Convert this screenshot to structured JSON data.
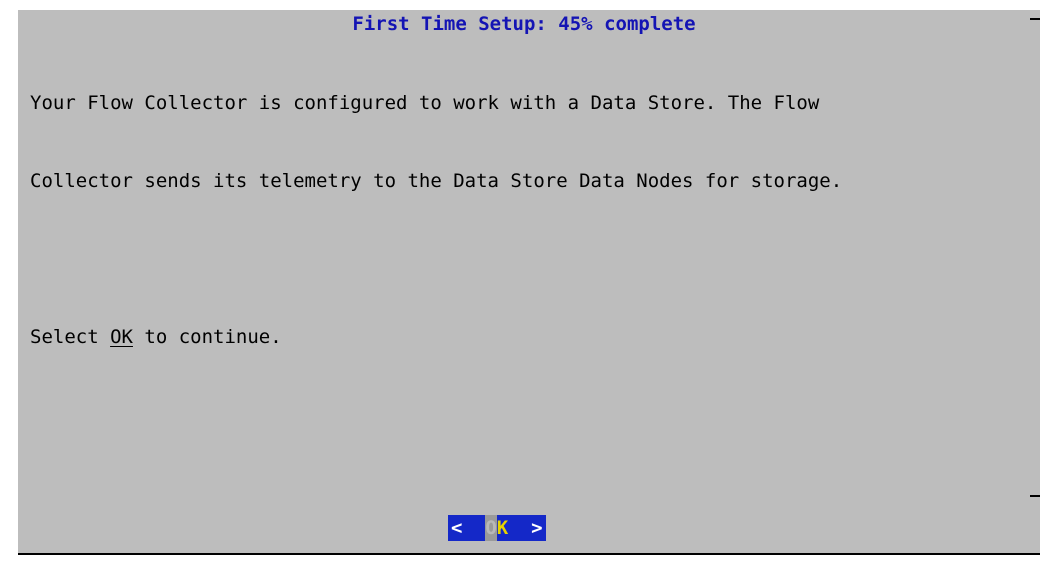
{
  "dialog": {
    "title": "First Time Setup: 45% complete",
    "body_lines": [
      "Your Flow Collector is configured to work with a Data Store. The Flow",
      "Collector sends its telemetry to the Data Store Data Nodes for storage."
    ],
    "prompt_prefix": "Select ",
    "prompt_keyword": "OK",
    "prompt_suffix": " to continue.",
    "progress_percent": 45
  },
  "button": {
    "left_bracket": "<",
    "hotkey": "O",
    "rest": "K",
    "right_bracket": ">"
  },
  "colors": {
    "dialog_background": "#bdbdbd",
    "title": "#1414b4",
    "button_background": "#1428c8",
    "button_text": "#e6d200"
  }
}
